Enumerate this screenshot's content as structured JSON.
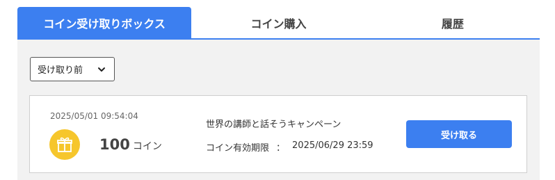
{
  "tabs": [
    {
      "label": "コイン受け取りボックス",
      "active": true
    },
    {
      "label": "コイン購入",
      "active": false
    },
    {
      "label": "履歴",
      "active": false
    }
  ],
  "filter": {
    "selected": "受け取り前",
    "icon": "chevron-down-icon"
  },
  "card": {
    "date": "2025/05/01 09:54:04",
    "icon": "gift-icon",
    "amount": "100",
    "unit": "コイン",
    "campaign": "世界の講師と話そうキャンペーン",
    "expiry_label": "コイン有効期限",
    "expiry_sep": "：",
    "expiry_value": "2025/06/29 23:59",
    "button_label": "受け取る"
  },
  "colors": {
    "accent": "#3c7ff0",
    "gift_bg": "#f6c62c",
    "panel_bg": "#f2f2f2"
  }
}
